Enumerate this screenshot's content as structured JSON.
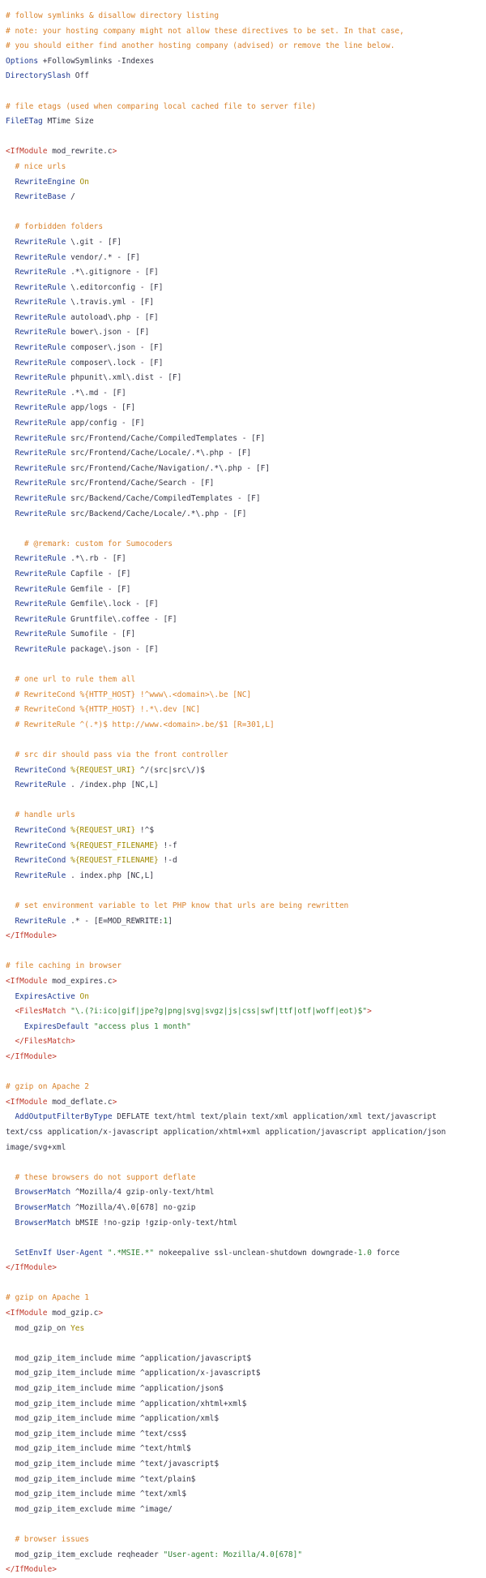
{
  "lines": [
    [
      [
        "c",
        "# follow symlinks & disallow directory listing"
      ]
    ],
    [
      [
        "c",
        "# note: your hosting company might not allow these directives to be set. In that case,"
      ]
    ],
    [
      [
        "c",
        "# you should either find another hosting company (advised) or remove the line below."
      ]
    ],
    [
      [
        "d",
        "Options"
      ],
      [
        "p",
        " +FollowSymlinks -Indexes"
      ]
    ],
    [
      [
        "d",
        "DirectorySlash"
      ],
      [
        "p",
        " Off"
      ]
    ],
    [],
    [
      [
        "c",
        "# file etags (used when comparing local cached file to server file)"
      ]
    ],
    [
      [
        "d",
        "FileETag"
      ],
      [
        "p",
        " MTime Size"
      ]
    ],
    [],
    [
      [
        "t",
        "<IfModule"
      ],
      [
        "p",
        " mod_rewrite.c"
      ],
      [
        "t",
        ">"
      ]
    ],
    [
      [
        "p",
        "  "
      ],
      [
        "c",
        "# nice urls"
      ]
    ],
    [
      [
        "p",
        "  "
      ],
      [
        "d",
        "RewriteEngine"
      ],
      [
        "p",
        " "
      ],
      [
        "k",
        "On"
      ]
    ],
    [
      [
        "p",
        "  "
      ],
      [
        "d",
        "RewriteBase"
      ],
      [
        "p",
        " /"
      ]
    ],
    [],
    [
      [
        "p",
        "  "
      ],
      [
        "c",
        "# forbidden folders"
      ]
    ],
    [
      [
        "p",
        "  "
      ],
      [
        "d",
        "RewriteRule"
      ],
      [
        "p",
        " \\.git - [F]"
      ]
    ],
    [
      [
        "p",
        "  "
      ],
      [
        "d",
        "RewriteRule"
      ],
      [
        "p",
        " vendor/.* - [F]"
      ]
    ],
    [
      [
        "p",
        "  "
      ],
      [
        "d",
        "RewriteRule"
      ],
      [
        "p",
        " .*\\.gitignore - [F]"
      ]
    ],
    [
      [
        "p",
        "  "
      ],
      [
        "d",
        "RewriteRule"
      ],
      [
        "p",
        " \\.editorconfig - [F]"
      ]
    ],
    [
      [
        "p",
        "  "
      ],
      [
        "d",
        "RewriteRule"
      ],
      [
        "p",
        " \\.travis.yml - [F]"
      ]
    ],
    [
      [
        "p",
        "  "
      ],
      [
        "d",
        "RewriteRule"
      ],
      [
        "p",
        " autoload\\.php - [F]"
      ]
    ],
    [
      [
        "p",
        "  "
      ],
      [
        "d",
        "RewriteRule"
      ],
      [
        "p",
        " bower\\.json - [F]"
      ]
    ],
    [
      [
        "p",
        "  "
      ],
      [
        "d",
        "RewriteRule"
      ],
      [
        "p",
        " composer\\.json - [F]"
      ]
    ],
    [
      [
        "p",
        "  "
      ],
      [
        "d",
        "RewriteRule"
      ],
      [
        "p",
        " composer\\.lock - [F]"
      ]
    ],
    [
      [
        "p",
        "  "
      ],
      [
        "d",
        "RewriteRule"
      ],
      [
        "p",
        " phpunit\\.xml\\.dist - [F]"
      ]
    ],
    [
      [
        "p",
        "  "
      ],
      [
        "d",
        "RewriteRule"
      ],
      [
        "p",
        " .*\\.md - [F]"
      ]
    ],
    [
      [
        "p",
        "  "
      ],
      [
        "d",
        "RewriteRule"
      ],
      [
        "p",
        " app/logs - [F]"
      ]
    ],
    [
      [
        "p",
        "  "
      ],
      [
        "d",
        "RewriteRule"
      ],
      [
        "p",
        " app/config - [F]"
      ]
    ],
    [
      [
        "p",
        "  "
      ],
      [
        "d",
        "RewriteRule"
      ],
      [
        "p",
        " src/Frontend/Cache/CompiledTemplates - [F]"
      ]
    ],
    [
      [
        "p",
        "  "
      ],
      [
        "d",
        "RewriteRule"
      ],
      [
        "p",
        " src/Frontend/Cache/Locale/.*\\.php - [F]"
      ]
    ],
    [
      [
        "p",
        "  "
      ],
      [
        "d",
        "RewriteRule"
      ],
      [
        "p",
        " src/Frontend/Cache/Navigation/.*\\.php - [F]"
      ]
    ],
    [
      [
        "p",
        "  "
      ],
      [
        "d",
        "RewriteRule"
      ],
      [
        "p",
        " src/Frontend/Cache/Search - [F]"
      ]
    ],
    [
      [
        "p",
        "  "
      ],
      [
        "d",
        "RewriteRule"
      ],
      [
        "p",
        " src/Backend/Cache/CompiledTemplates - [F]"
      ]
    ],
    [
      [
        "p",
        "  "
      ],
      [
        "d",
        "RewriteRule"
      ],
      [
        "p",
        " src/Backend/Cache/Locale/.*\\.php - [F]"
      ]
    ],
    [],
    [
      [
        "p",
        "    "
      ],
      [
        "c",
        "# @remark: custom for Sumocoders"
      ]
    ],
    [
      [
        "p",
        "  "
      ],
      [
        "d",
        "RewriteRule"
      ],
      [
        "p",
        " .*\\.rb - [F]"
      ]
    ],
    [
      [
        "p",
        "  "
      ],
      [
        "d",
        "RewriteRule"
      ],
      [
        "p",
        " Capfile - [F]"
      ]
    ],
    [
      [
        "p",
        "  "
      ],
      [
        "d",
        "RewriteRule"
      ],
      [
        "p",
        " Gemfile - [F]"
      ]
    ],
    [
      [
        "p",
        "  "
      ],
      [
        "d",
        "RewriteRule"
      ],
      [
        "p",
        " Gemfile\\.lock - [F]"
      ]
    ],
    [
      [
        "p",
        "  "
      ],
      [
        "d",
        "RewriteRule"
      ],
      [
        "p",
        " Gruntfile\\.coffee - [F]"
      ]
    ],
    [
      [
        "p",
        "  "
      ],
      [
        "d",
        "RewriteRule"
      ],
      [
        "p",
        " Sumofile - [F]"
      ]
    ],
    [
      [
        "p",
        "  "
      ],
      [
        "d",
        "RewriteRule"
      ],
      [
        "p",
        " package\\.json - [F]"
      ]
    ],
    [],
    [
      [
        "p",
        "  "
      ],
      [
        "c",
        "# one url to rule them all"
      ]
    ],
    [
      [
        "p",
        "  "
      ],
      [
        "c",
        "# RewriteCond %{HTTP_HOST} !^www\\.<domain>\\.be [NC]"
      ]
    ],
    [
      [
        "p",
        "  "
      ],
      [
        "c",
        "# RewriteCond %{HTTP_HOST} !.*\\.dev [NC]"
      ]
    ],
    [
      [
        "p",
        "  "
      ],
      [
        "c",
        "# RewriteRule ^(.*)$ http://www.<domain>.be/$1 [R=301,L]"
      ]
    ],
    [],
    [
      [
        "p",
        "  "
      ],
      [
        "c",
        "# src dir should pass via the front controller"
      ]
    ],
    [
      [
        "p",
        "  "
      ],
      [
        "d",
        "RewriteCond"
      ],
      [
        "p",
        " "
      ],
      [
        "k",
        "%{REQUEST_URI}"
      ],
      [
        "p",
        " ^/(src|src\\/)$"
      ]
    ],
    [
      [
        "p",
        "  "
      ],
      [
        "d",
        "RewriteRule"
      ],
      [
        "p",
        " . /index.php [NC,L]"
      ]
    ],
    [],
    [
      [
        "p",
        "  "
      ],
      [
        "c",
        "# handle urls"
      ]
    ],
    [
      [
        "p",
        "  "
      ],
      [
        "d",
        "RewriteCond"
      ],
      [
        "p",
        " "
      ],
      [
        "k",
        "%{REQUEST_URI}"
      ],
      [
        "p",
        " !^$"
      ]
    ],
    [
      [
        "p",
        "  "
      ],
      [
        "d",
        "RewriteCond"
      ],
      [
        "p",
        " "
      ],
      [
        "k",
        "%{REQUEST_FILENAME}"
      ],
      [
        "p",
        " !-f"
      ]
    ],
    [
      [
        "p",
        "  "
      ],
      [
        "d",
        "RewriteCond"
      ],
      [
        "p",
        " "
      ],
      [
        "k",
        "%{REQUEST_FILENAME}"
      ],
      [
        "p",
        " !-d"
      ]
    ],
    [
      [
        "p",
        "  "
      ],
      [
        "d",
        "RewriteRule"
      ],
      [
        "p",
        " . index.php [NC,L]"
      ]
    ],
    [],
    [
      [
        "p",
        "  "
      ],
      [
        "c",
        "# set environment variable to let PHP know that urls are being rewritten"
      ]
    ],
    [
      [
        "p",
        "  "
      ],
      [
        "d",
        "RewriteRule"
      ],
      [
        "p",
        " .* - [E=MOD_REWRITE:"
      ],
      [
        "n",
        "1"
      ],
      [
        "p",
        "]"
      ]
    ],
    [
      [
        "t",
        "</IfModule>"
      ]
    ],
    [],
    [
      [
        "c",
        "# file caching in browser"
      ]
    ],
    [
      [
        "t",
        "<IfModule"
      ],
      [
        "p",
        " mod_expires.c"
      ],
      [
        "t",
        ">"
      ]
    ],
    [
      [
        "p",
        "  "
      ],
      [
        "d",
        "ExpiresActive"
      ],
      [
        "p",
        " "
      ],
      [
        "k",
        "On"
      ]
    ],
    [
      [
        "p",
        "  "
      ],
      [
        "t",
        "<FilesMatch"
      ],
      [
        "p",
        " "
      ],
      [
        "s",
        "\"\\.(?i:ico|gif|jpe?g|png|svg|svgz|js|css|swf|ttf|otf|woff|eot)$\""
      ],
      [
        "t",
        ">"
      ]
    ],
    [
      [
        "p",
        "    "
      ],
      [
        "d",
        "ExpiresDefault"
      ],
      [
        "p",
        " "
      ],
      [
        "s",
        "\"access plus 1 month\""
      ]
    ],
    [
      [
        "p",
        "  "
      ],
      [
        "t",
        "</FilesMatch>"
      ]
    ],
    [
      [
        "t",
        "</IfModule>"
      ]
    ],
    [],
    [
      [
        "c",
        "# gzip on Apache 2"
      ]
    ],
    [
      [
        "t",
        "<IfModule"
      ],
      [
        "p",
        " mod_deflate.c"
      ],
      [
        "t",
        ">"
      ]
    ],
    [
      [
        "p",
        "  "
      ],
      [
        "d",
        "AddOutputFilterByType"
      ],
      [
        "p",
        " DEFLATE text/html text/plain text/xml application/xml text/javascript"
      ]
    ],
    [
      [
        "p",
        "text/css application/x-javascript application/xhtml+xml application/javascript application/json"
      ]
    ],
    [
      [
        "p",
        "image/svg+xml"
      ]
    ],
    [],
    [
      [
        "p",
        "  "
      ],
      [
        "c",
        "# these browsers do not support deflate"
      ]
    ],
    [
      [
        "p",
        "  "
      ],
      [
        "d",
        "BrowserMatch"
      ],
      [
        "p",
        " ^Mozilla/4 gzip-only-text/html"
      ]
    ],
    [
      [
        "p",
        "  "
      ],
      [
        "d",
        "BrowserMatch"
      ],
      [
        "p",
        " ^Mozilla/4\\.0[678] no-gzip"
      ]
    ],
    [
      [
        "p",
        "  "
      ],
      [
        "d",
        "BrowserMatch"
      ],
      [
        "p",
        " bMSIE !no-gzip !gzip-only-text/html"
      ]
    ],
    [],
    [
      [
        "p",
        "  "
      ],
      [
        "d",
        "SetEnvIf"
      ],
      [
        "p",
        " "
      ],
      [
        "d",
        "User-Agent"
      ],
      [
        "p",
        " "
      ],
      [
        "s",
        "\".*MSIE.*\""
      ],
      [
        "p",
        " nokeepalive ssl-unclean-shutdown downgrade-"
      ],
      [
        "n",
        "1.0"
      ],
      [
        "p",
        " force"
      ]
    ],
    [
      [
        "t",
        "</IfModule>"
      ]
    ],
    [],
    [
      [
        "c",
        "# gzip on Apache 1"
      ]
    ],
    [
      [
        "t",
        "<IfModule"
      ],
      [
        "p",
        " mod_gzip.c"
      ],
      [
        "t",
        ">"
      ]
    ],
    [
      [
        "p",
        "  mod_gzip_on "
      ],
      [
        "k",
        "Yes"
      ]
    ],
    [],
    [
      [
        "p",
        "  mod_gzip_item_include mime ^application/javascript$"
      ]
    ],
    [
      [
        "p",
        "  mod_gzip_item_include mime ^application/x-javascript$"
      ]
    ],
    [
      [
        "p",
        "  mod_gzip_item_include mime ^application/json$"
      ]
    ],
    [
      [
        "p",
        "  mod_gzip_item_include mime ^application/xhtml+xml$"
      ]
    ],
    [
      [
        "p",
        "  mod_gzip_item_include mime ^application/xml$"
      ]
    ],
    [
      [
        "p",
        "  mod_gzip_item_include mime ^text/css$"
      ]
    ],
    [
      [
        "p",
        "  mod_gzip_item_include mime ^text/html$"
      ]
    ],
    [
      [
        "p",
        "  mod_gzip_item_include mime ^text/javascript$"
      ]
    ],
    [
      [
        "p",
        "  mod_gzip_item_include mime ^text/plain$"
      ]
    ],
    [
      [
        "p",
        "  mod_gzip_item_include mime ^text/xml$"
      ]
    ],
    [
      [
        "p",
        "  mod_gzip_item_exclude mime ^image/"
      ]
    ],
    [],
    [
      [
        "p",
        "  "
      ],
      [
        "c",
        "# browser issues"
      ]
    ],
    [
      [
        "p",
        "  mod_gzip_item_exclude reqheader "
      ],
      [
        "s",
        "\"User-agent: Mozilla/4.0[678]\""
      ]
    ],
    [
      [
        "t",
        "</IfModule>"
      ]
    ]
  ]
}
